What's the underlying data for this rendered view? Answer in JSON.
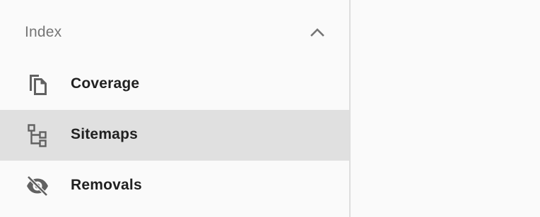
{
  "sidebar": {
    "section": {
      "title": "Index",
      "expanded": true
    },
    "items": [
      {
        "label": "Coverage",
        "icon": "file-copy-icon",
        "selected": false
      },
      {
        "label": "Sitemaps",
        "icon": "sitemap-tree-icon",
        "selected": true
      },
      {
        "label": "Removals",
        "icon": "eye-off-icon",
        "selected": false
      }
    ]
  },
  "colors": {
    "background": "#fafafa",
    "selected_row": "#e0e0e0",
    "icon": "#616161",
    "section_title": "#757575",
    "item_label": "#212121",
    "divider": "#dedede"
  }
}
